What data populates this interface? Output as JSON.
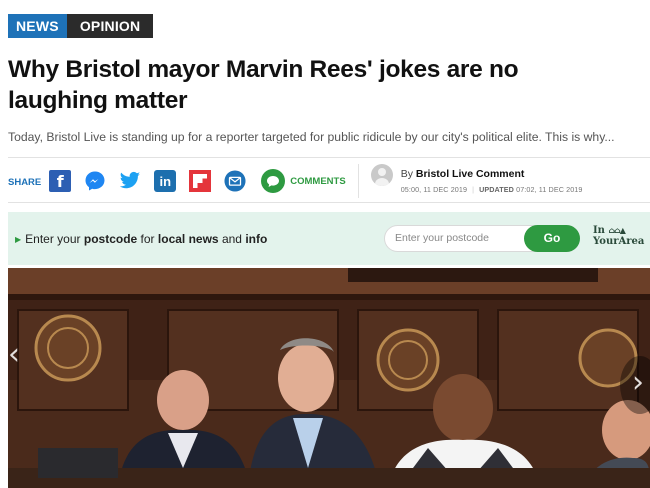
{
  "tags": {
    "section": "NEWS",
    "subsection": "OPINION"
  },
  "headline": "Why Bristol mayor Marvin Rees' jokes are no laughing matter",
  "standfirst": "Today, Bristol Live is standing up for a reporter targeted for public ridicule by our city's political elite. This is why...",
  "share": {
    "label": "SHARE",
    "icons": [
      "facebook-icon",
      "messenger-icon",
      "twitter-icon",
      "linkedin-icon",
      "flipboard-icon",
      "email-icon"
    ],
    "facebook_glyph": "f",
    "linkedin_glyph": "in",
    "comments_label": "COMMENTS"
  },
  "author": {
    "by": "By",
    "name": "Bristol Live Comment",
    "published": "05:00, 11 DEC 2019",
    "updated_label": "UPDATED",
    "updated": "07:02, 11 DEC 2019"
  },
  "postcode": {
    "prefix": "Enter your",
    "bold1": "postcode",
    "mid": "for",
    "bold2": "local news",
    "and": "and",
    "bold3": "info",
    "placeholder": "Enter your postcode",
    "button": "Go",
    "brand_top": "In",
    "brand_bottom": "YourArea"
  },
  "colors": {
    "news_tag": "#1e72b8",
    "opinion_tag": "#2b2b2b",
    "accent_green": "#2e9a41",
    "postcode_bg": "#e3f3ec"
  }
}
